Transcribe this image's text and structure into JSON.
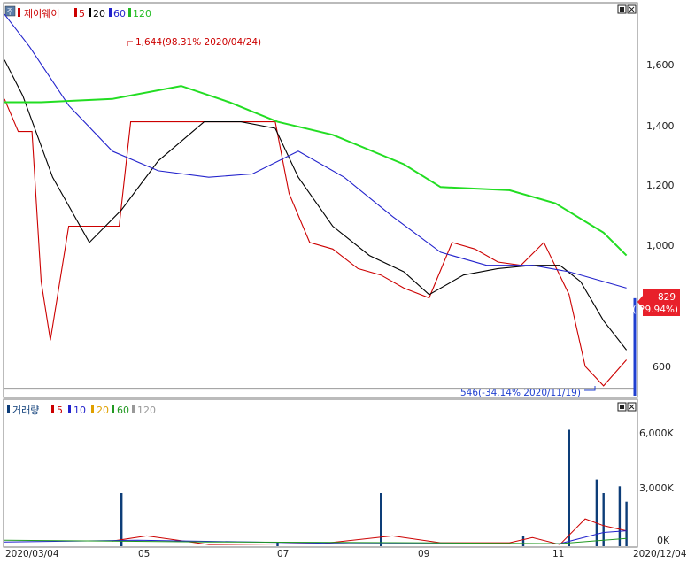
{
  "header_price": {
    "stock_name": "제이웨이",
    "ma_labels": [
      "5",
      "20",
      "60",
      "120"
    ]
  },
  "header_volume": {
    "title": "거래량",
    "ma_labels": [
      "5",
      "10",
      "20",
      "60",
      "120"
    ]
  },
  "annotations": {
    "high": "1,644(98.31% 2020/04/24)",
    "low": "546(-34.14% 2020/11/19)",
    "current_price": "829",
    "current_pct": "( 29.94%)"
  },
  "colors": {
    "up": "#e8202a",
    "down": "#1f3fd0",
    "ma5": "#cc0000",
    "ma20": "#000000",
    "ma60": "#2222cc",
    "ma120": "#22dd22",
    "vol_bar": "#0d3d78",
    "vma5": "#cc0000",
    "vma10": "#2222cc",
    "vma20": "#e0a000",
    "vma60": "#229922",
    "vma120": "#999999"
  },
  "chart_data": [
    {
      "type": "line",
      "title": "제이웨이",
      "x_tick_labels": [
        "2020/03/04",
        "05",
        "07",
        "09",
        "11",
        "2020/12/04"
      ],
      "y_tick_labels": [
        "600",
        "800",
        "1,000",
        "1,200",
        "1,400",
        "1,600"
      ],
      "ylim": [
        530,
        1730
      ],
      "grid": false,
      "date_range": [
        "2020/03/04",
        "2020/12/04"
      ],
      "series": [
        {
          "name": "5",
          "x": [
            "2020/03/04",
            "2020/03/10",
            "2020/03/16",
            "2020/03/20",
            "2020/03/24",
            "2020/04/01",
            "2020/04/10",
            "2020/04/23",
            "2020/04/28",
            "2020/05/06",
            "2020/05/20",
            "2020/06/10",
            "2020/06/30",
            "2020/07/06",
            "2020/07/15",
            "2020/07/25",
            "2020/08/05",
            "2020/08/15",
            "2020/08/25",
            "2020/09/05",
            "2020/09/15",
            "2020/09/25",
            "2020/10/05",
            "2020/10/15",
            "2020/10/25",
            "2020/11/05",
            "2020/11/12",
            "2020/11/20",
            "2020/11/30"
          ],
          "values": [
            1440,
            1340,
            1340,
            880,
            700,
            1050,
            1050,
            1050,
            1370,
            1370,
            1370,
            1370,
            1370,
            1150,
            1000,
            980,
            920,
            900,
            860,
            830,
            1000,
            980,
            940,
            930,
            1000,
            840,
            620,
            560,
            640
          ]
        },
        {
          "name": "20",
          "x": [
            "2020/03/04",
            "2020/03/12",
            "2020/03/25",
            "2020/04/10",
            "2020/04/24",
            "2020/05/10",
            "2020/05/30",
            "2020/06/15",
            "2020/06/30",
            "2020/07/10",
            "2020/07/25",
            "2020/08/10",
            "2020/08/25",
            "2020/09/05",
            "2020/09/20",
            "2020/10/05",
            "2020/10/20",
            "2020/11/01",
            "2020/11/10",
            "2020/11/20",
            "2020/11/30"
          ],
          "values": [
            1560,
            1450,
            1200,
            1000,
            1100,
            1250,
            1370,
            1370,
            1350,
            1200,
            1050,
            960,
            910,
            840,
            900,
            920,
            930,
            930,
            880,
            760,
            670
          ]
        },
        {
          "name": "60",
          "x": [
            "2020/03/04",
            "2020/03/15",
            "2020/04/01",
            "2020/04/20",
            "2020/05/10",
            "2020/06/01",
            "2020/06/20",
            "2020/07/10",
            "2020/07/30",
            "2020/08/20",
            "2020/09/10",
            "2020/09/30",
            "2020/10/20",
            "2020/11/05",
            "2020/11/30"
          ],
          "values": [
            1700,
            1600,
            1420,
            1280,
            1220,
            1200,
            1210,
            1280,
            1200,
            1080,
            970,
            930,
            930,
            910,
            860
          ]
        },
        {
          "name": "120",
          "x": [
            "2020/03/04",
            "2020/03/20",
            "2020/04/20",
            "2020/05/20",
            "2020/06/10",
            "2020/07/01",
            "2020/07/25",
            "2020/08/25",
            "2020/09/10",
            "2020/10/10",
            "2020/10/30",
            "2020/11/20",
            "2020/11/30"
          ],
          "values": [
            1430,
            1430,
            1440,
            1480,
            1430,
            1370,
            1330,
            1240,
            1170,
            1160,
            1120,
            1030,
            960
          ]
        }
      ],
      "annotations": [
        {
          "label": "1,644(98.31% 2020/04/24)",
          "x": "2020/04/24",
          "y": 1644
        },
        {
          "label": "546(-34.14% 2020/11/19)",
          "x": "2020/11/19",
          "y": 546
        }
      ],
      "current": {
        "value": 829,
        "change_pct": 29.94
      }
    },
    {
      "type": "bar",
      "title": "거래량",
      "y_tick_labels": [
        "0K",
        "3,000K",
        "6,000K"
      ],
      "ylim": [
        0,
        7600
      ],
      "units": "K",
      "x": [
        "2020/04/24",
        "2020/07/01",
        "2020/08/15",
        "2020/10/16",
        "2020/11/05",
        "2020/11/17",
        "2020/11/20",
        "2020/11/27",
        "2020/11/30"
      ],
      "values": [
        3100,
        260,
        3100,
        600,
        6800,
        3900,
        3100,
        3500,
        2600
      ],
      "series": [
        {
          "name": "5",
          "x": [
            "2020/04/20",
            "2020/05/05",
            "2020/06/01",
            "2020/07/20",
            "2020/08/20",
            "2020/09/10",
            "2020/10/10",
            "2020/10/20",
            "2020/11/01",
            "2020/11/12",
            "2020/11/20",
            "2020/11/30"
          ],
          "values": [
            300,
            600,
            100,
            150,
            600,
            200,
            200,
            500,
            100,
            1600,
            1200,
            900
          ]
        },
        {
          "name": "10",
          "x": [
            "2020/03/04",
            "2020/05/01",
            "2020/08/01",
            "2020/11/01",
            "2020/11/20",
            "2020/11/30"
          ],
          "values": [
            250,
            350,
            150,
            150,
            800,
            900
          ]
        },
        {
          "name": "60",
          "x": [
            "2020/03/04",
            "2020/06/01",
            "2020/09/01",
            "2020/11/01",
            "2020/11/30"
          ],
          "values": [
            350,
            250,
            200,
            150,
            450
          ]
        }
      ]
    }
  ]
}
